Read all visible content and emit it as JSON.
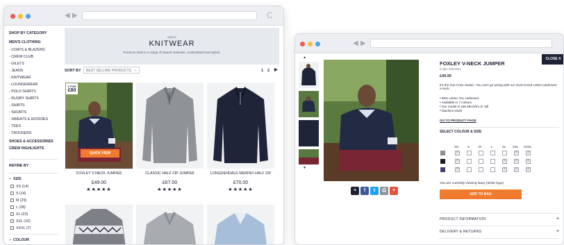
{
  "colors": {
    "accent": "#f07b2f",
    "navy": "#1d2235",
    "dot_red": "#ee5a5a",
    "dot_yellow": "#f6bd3b",
    "dot_blue": "#4aa6e8"
  },
  "left": {
    "sidebar": {
      "shop_heading": "SHOP BY CATEGORY",
      "mens_heading": "MEN'S CLOTHING",
      "items": [
        "- COATS & BLAZERS",
        "- CREW CLUB",
        "- GILETS",
        "- JEANS",
        "- KNITWEAR",
        "- LOUNGEWEAR",
        "- POLO SHIRTS",
        "- RUGBY SHIRTS",
        "- SHIRTS",
        "- SHORTS",
        "- SWEATS & HOODIES",
        "- TEES",
        "- TROUSERS"
      ],
      "shoes": "SHOES & ACCESSORIES",
      "highlights": "CREW HIGHLIGHTS",
      "refine": "REFINE BY",
      "size_heading": "SIZE",
      "sizes": [
        "XS (14)",
        "S (14)",
        "M (29)",
        "L (28)",
        "XL (23)",
        "XXL (16)",
        "XXXL (7)"
      ],
      "colour_heading": "COLOUR"
    },
    "banner": {
      "kicker": "MEN'S",
      "title": "KNITWEAR",
      "subtitle": "Premium knits in a range of natural materials. Understated and stylish."
    },
    "sort": {
      "label": "SORT BY",
      "value": "BEST SELLING PRODUCTS",
      "page1": "1",
      "page2": "2",
      "next_icon": "chevron-right-icon"
    },
    "products": [
      {
        "name": "FOXLEY V-NECK JUMPER",
        "price": "£49.00",
        "stars": "★★★★★",
        "badge_top": "2 FOR",
        "badge_bottom": "£80",
        "quick": "QUICK VIEW"
      },
      {
        "name": "CLASSIC HALF ZIP JUMPER",
        "price": "£67.00",
        "stars": "★★★★★"
      },
      {
        "name": "LONGDENDALE MERINO HALF ZIP",
        "price": "£70.00",
        "stars": "★★★★★"
      }
    ]
  },
  "right": {
    "close": "CLOSE X",
    "title": "FOXLEY V-NECK JUMPER",
    "code": "Code: MZC001",
    "price": "£49.00",
    "desc": "It's the true Crew classic. You can't go wrong with our much-loved cotton-cashmere v-neck.",
    "bullets": [
      "• 95% cotton, 5% cashmere",
      "• Available in 7 colours",
      "• Our model is 186.69cm/6'1.5\" tall",
      "• Machine wash"
    ],
    "go_link": "GO TO PRODUCT PAGE",
    "select_label": "SELECT COLOUR & SIZE",
    "sizes": [
      "XS",
      "S",
      "M",
      "L",
      "XL",
      "XXL",
      "XXXL"
    ],
    "viewing": "You are currently viewing Navy (white logo)",
    "add": "ADD TO BAG",
    "accordion": [
      "PRODUCT INFORMATION",
      "DELIVERY & RETURNS"
    ],
    "plus": "+",
    "social_icons": [
      "layers-icon",
      "facebook-icon",
      "twitter-icon",
      "print-icon",
      "plus-icon"
    ],
    "social_glyphs": [
      "≡",
      "f",
      "t",
      "⎙",
      "+"
    ]
  }
}
